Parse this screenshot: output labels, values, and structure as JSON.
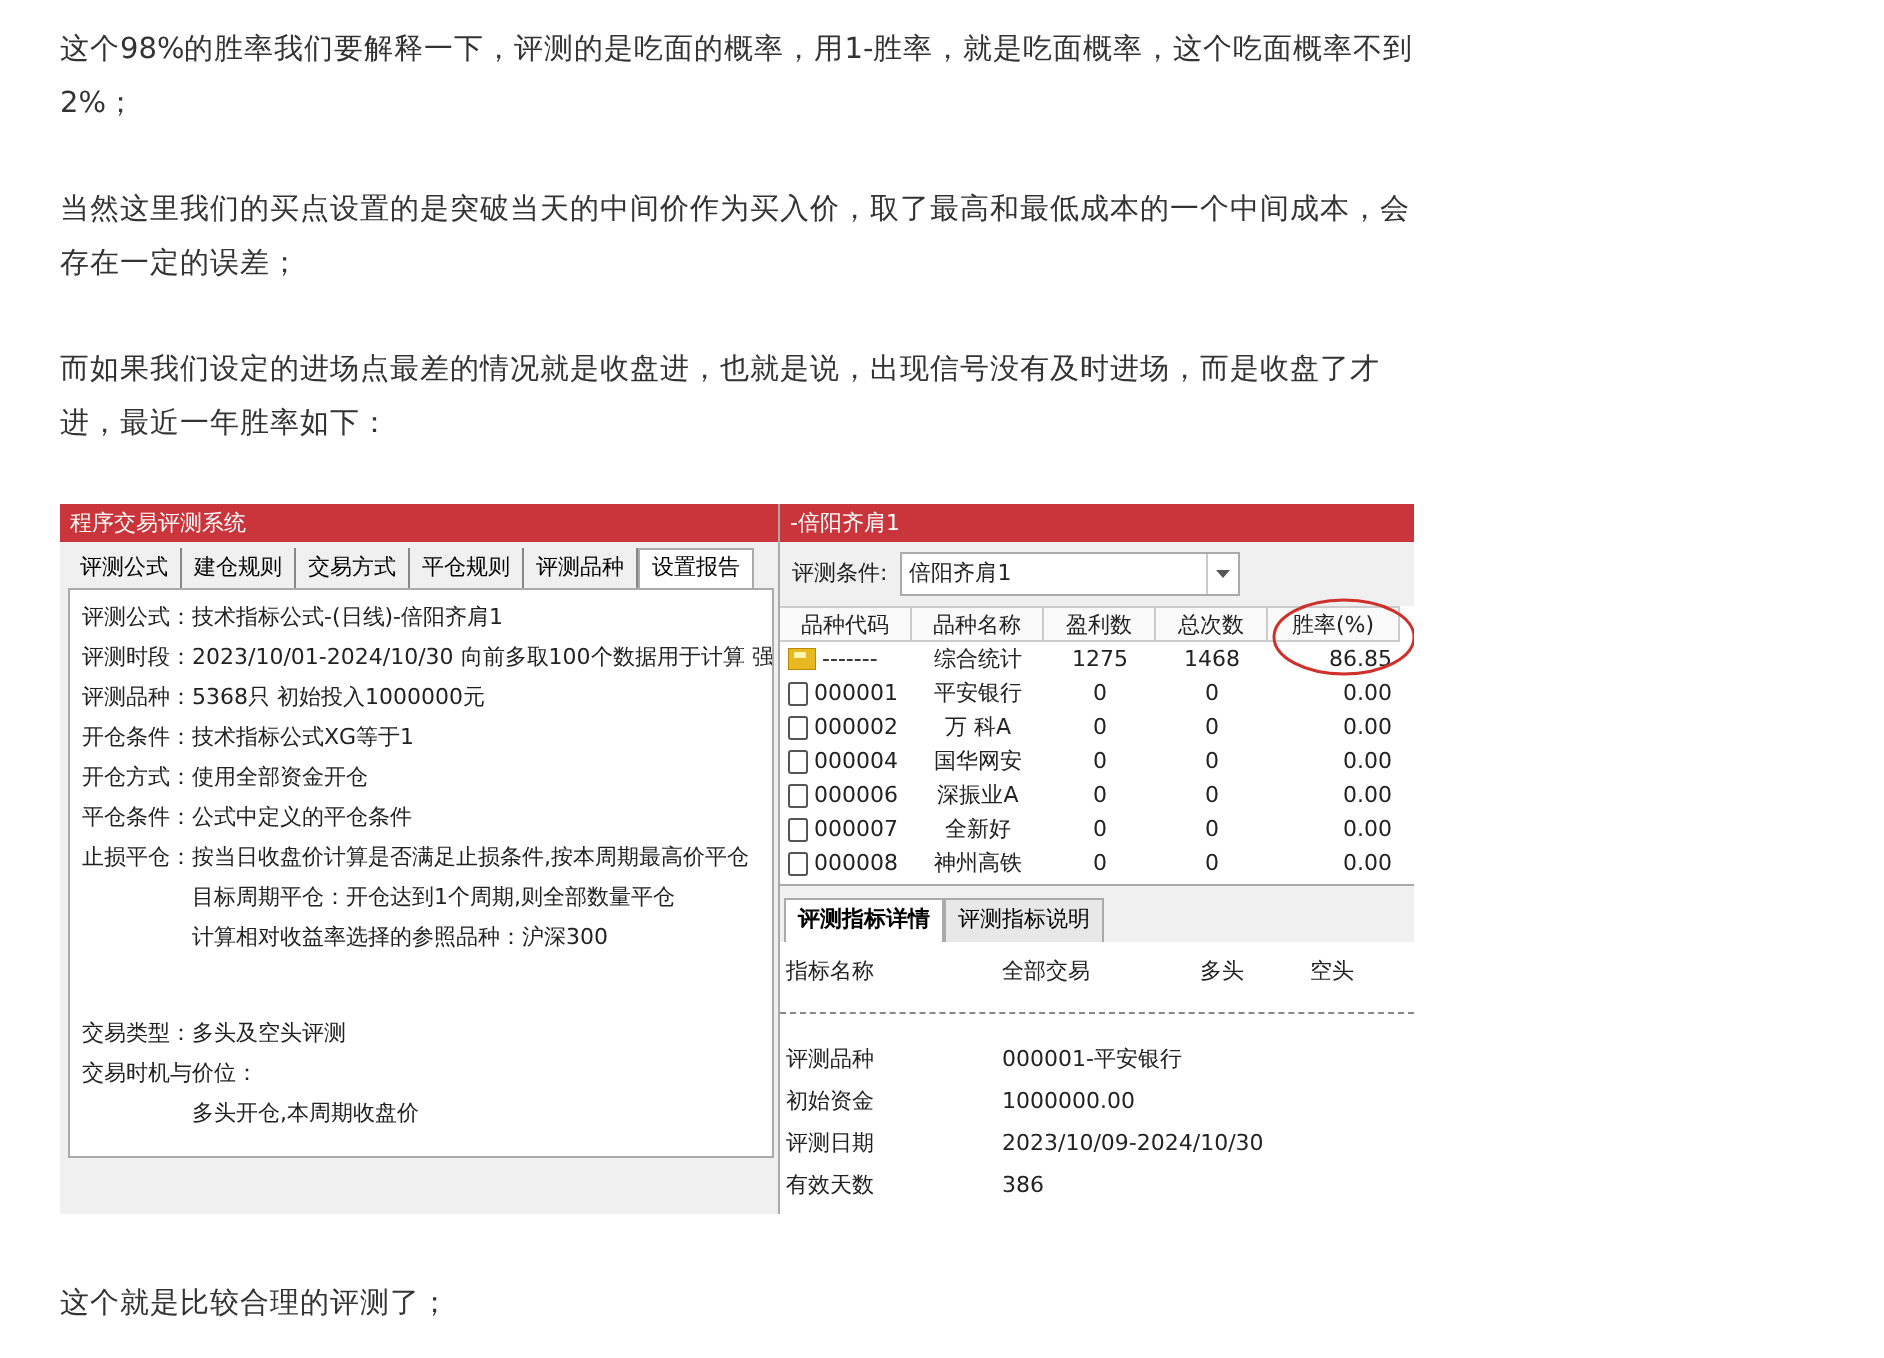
{
  "paragraphs_top": [
    "这个98%的胜率我们要解释一下，评测的是吃面的概率，用1-胜率，就是吃面概率，这个吃面概率不到2%；",
    "当然这里我们的买点设置的是突破当天的中间价作为买入价，取了最高和最低成本的一个中间成本，会存在一定的误差；",
    "而如果我们设定的进场点最差的情况就是收盘进，也就是说，出现信号没有及时进场，而是收盘了才进，最近一年胜率如下："
  ],
  "left_window": {
    "title": "程序交易评测系统",
    "tabs": [
      {
        "label": "评测公式",
        "selected": false
      },
      {
        "label": "建仓规则",
        "selected": false
      },
      {
        "label": "交易方式",
        "selected": false
      },
      {
        "label": "平仓规则",
        "selected": false
      },
      {
        "label": "评测品种",
        "selected": false
      },
      {
        "label": "设置报告",
        "selected": true
      }
    ],
    "lines": [
      {
        "label": "评测公式：",
        "value": "技术指标公式-(日线)-倍阳齐肩1"
      },
      {
        "label": "评测时段：",
        "value": "2023/10/01-2024/10/30 向前多取100个数据用于计算 强"
      },
      {
        "label": "评测品种：",
        "value": "5368只 初始投入1000000元"
      },
      {
        "label": "开仓条件：",
        "value": "技术指标公式XG等于1"
      },
      {
        "label": "开仓方式：",
        "value": "使用全部资金开仓"
      },
      {
        "label": "平仓条件：",
        "value": "公式中定义的平仓条件"
      },
      {
        "label": "止损平仓：",
        "value": "按当日收盘价计算是否满足止损条件,按本周期最高价平仓"
      },
      {
        "value": "目标周期平仓：开仓达到1个周期,则全部数量平仓"
      },
      {
        "value": "计算相对收益率选择的参照品种：沪深300"
      },
      {
        "kind": "gap"
      },
      {
        "label": "交易类型：",
        "value": "多头及空头评测"
      },
      {
        "label": "交易时机与价位："
      },
      {
        "value": "多头开仓,本周期收盘价"
      }
    ]
  },
  "right_window": {
    "title": "-倍阳齐肩1",
    "condition": {
      "label": "评测条件:",
      "value": "倍阳齐肩1"
    },
    "table": {
      "columns": [
        "品种代码",
        "品种名称",
        "盈利数",
        "总次数",
        "胜率(%)"
      ],
      "rows": [
        {
          "kind": "summary",
          "cells": [
            "-------",
            "综合统计",
            "1275",
            "1468",
            "86.85"
          ]
        },
        {
          "kind": "stock",
          "cells": [
            "000001",
            "平安银行",
            "0",
            "0",
            "0.00"
          ]
        },
        {
          "kind": "stock",
          "cells": [
            "000002",
            "万 科A",
            "0",
            "0",
            "0.00"
          ]
        },
        {
          "kind": "stock",
          "cells": [
            "000004",
            "国华网安",
            "0",
            "0",
            "0.00"
          ]
        },
        {
          "kind": "stock",
          "cells": [
            "000006",
            "深振业A",
            "0",
            "0",
            "0.00"
          ]
        },
        {
          "kind": "stock",
          "cells": [
            "000007",
            "全新好",
            "0",
            "0",
            "0.00"
          ]
        },
        {
          "kind": "stock",
          "cells": [
            "000008",
            "神州高铁",
            "0",
            "0",
            "0.00"
          ]
        }
      ]
    },
    "detail_tabs": [
      {
        "label": "评测指标详情",
        "selected": true
      },
      {
        "label": "评测指标说明",
        "selected": false
      }
    ],
    "detail_columns": [
      "指标名称",
      "全部交易",
      "多头",
      "空头"
    ],
    "detail_rows": [
      [
        "评测品种",
        "000001-平安银行"
      ],
      [
        "初始资金",
        "1000000.00"
      ],
      [
        "评测日期",
        "2023/10/09-2024/10/30"
      ],
      [
        "有效天数",
        "386"
      ]
    ]
  },
  "paragraph_bottom": "这个就是比较合理的评测了；"
}
